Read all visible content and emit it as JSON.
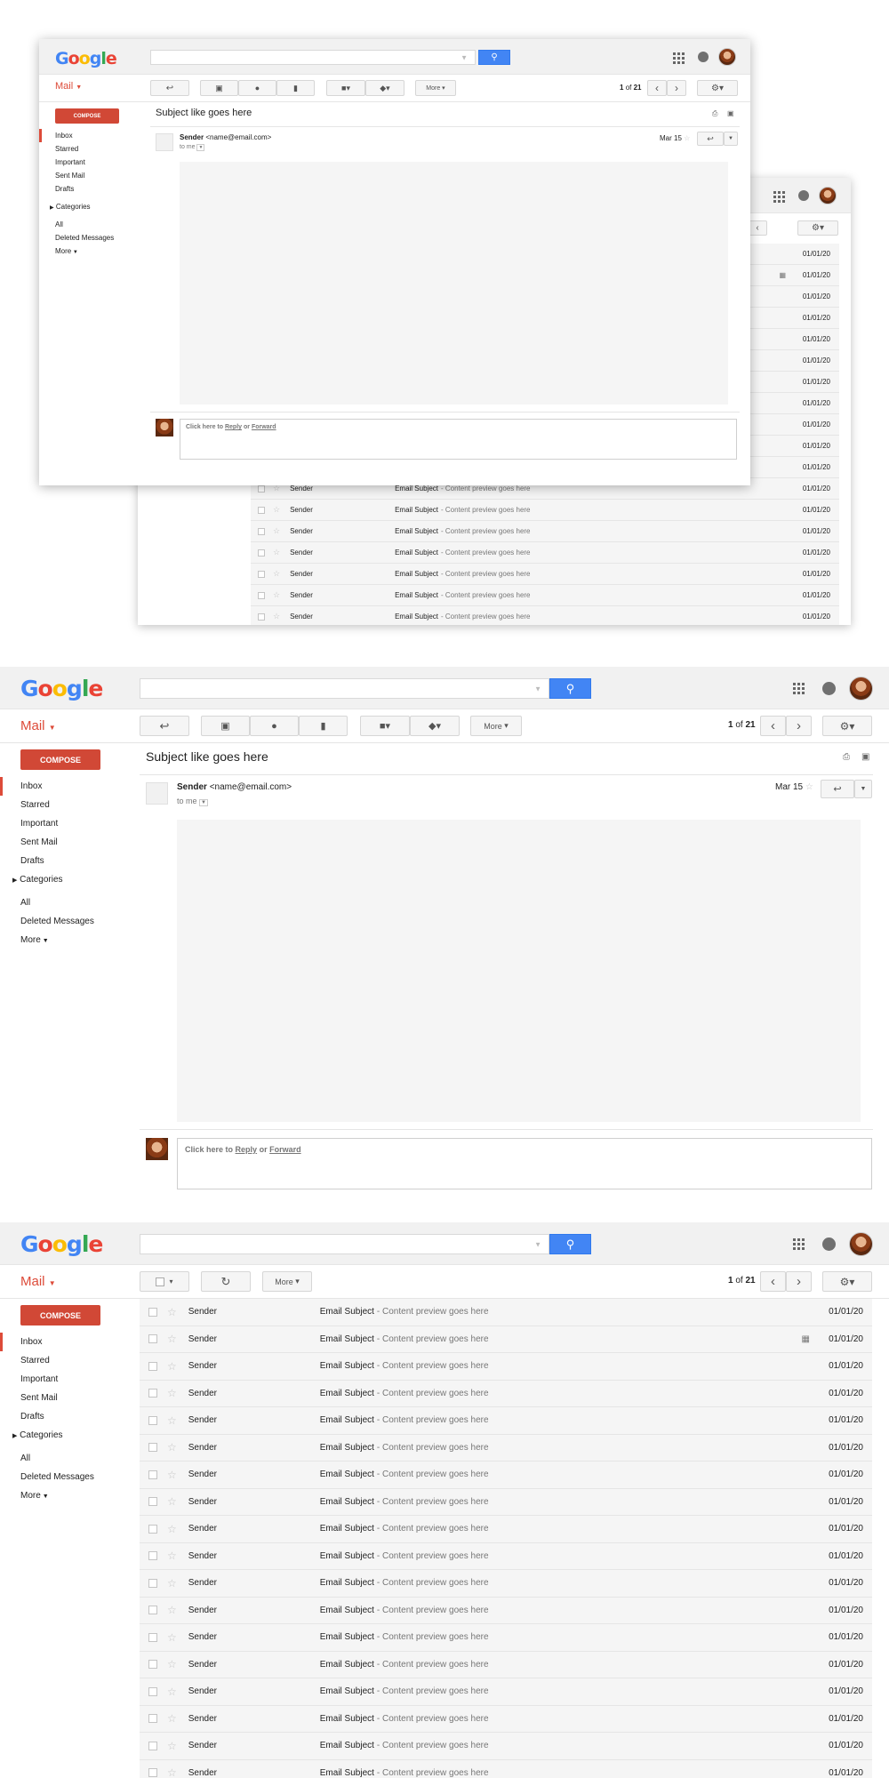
{
  "logo": {
    "g1": "G",
    "o1": "o",
    "o2": "o",
    "g2": "g",
    "l": "l",
    "e": "e"
  },
  "nav": {
    "mail_label": "Mail",
    "compose": "COMPOSE",
    "inbox": "Inbox",
    "starred": "Starred",
    "important": "Important",
    "sent": "Sent Mail",
    "drafts": "Drafts",
    "categories": "Categories",
    "all": "All",
    "deleted": "Deleted Messages",
    "more": "More"
  },
  "toolbar": {
    "more": "More",
    "page_current": "1",
    "page_of": "of",
    "page_total": "21"
  },
  "message": {
    "subject": "Subject like goes here",
    "sender_name": "Sender",
    "sender_email": "<name@email.com>",
    "to": "to me",
    "date": "Mar 15"
  },
  "reply": {
    "prefix": "Click here to",
    "reply": "Reply",
    "or": "or",
    "forward": "Forward"
  },
  "list": {
    "sender": "Sender",
    "subject": "Email Subject",
    "preview": "- Content preview goes here",
    "date": "01/01/20"
  },
  "colors": {
    "accent": "#dd4b39",
    "search": "#4285f4",
    "compose": "#d14836"
  },
  "icons": [
    "reply-icon",
    "archive-icon",
    "report-spam-icon",
    "delete-icon",
    "folder-icon",
    "label-icon",
    "chevron-left-icon",
    "chevron-right-icon",
    "settings-icon",
    "print-icon",
    "new-window-icon",
    "refresh-icon",
    "star-icon",
    "calendar-icon",
    "apps-icon",
    "notifications-icon"
  ]
}
